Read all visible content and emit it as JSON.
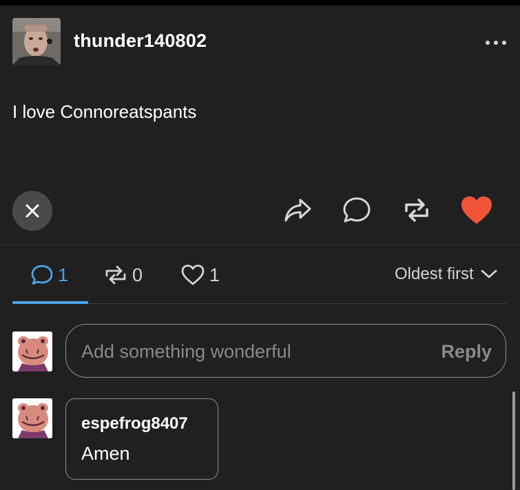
{
  "post": {
    "username": "thunder140802",
    "body": "I love Connoreatspants",
    "more_icon": "more-dots-icon"
  },
  "actions": {
    "close_icon": "close-icon",
    "share_icon": "share-icon",
    "comment_icon": "comment-icon",
    "reblog_icon": "reblog-icon",
    "like_icon": "heart-filled-icon",
    "like_color": "#f0553a"
  },
  "stats": {
    "replies": "1",
    "reblogs": "0",
    "likes": "1",
    "accent_color": "#4aa3e6"
  },
  "sort": {
    "label": "Oldest first",
    "icon": "chevron-down-icon"
  },
  "reply": {
    "placeholder": "Add something wonderful",
    "button": "Reply"
  },
  "comments": [
    {
      "author": "espefrog8407",
      "text": "Amen"
    }
  ]
}
